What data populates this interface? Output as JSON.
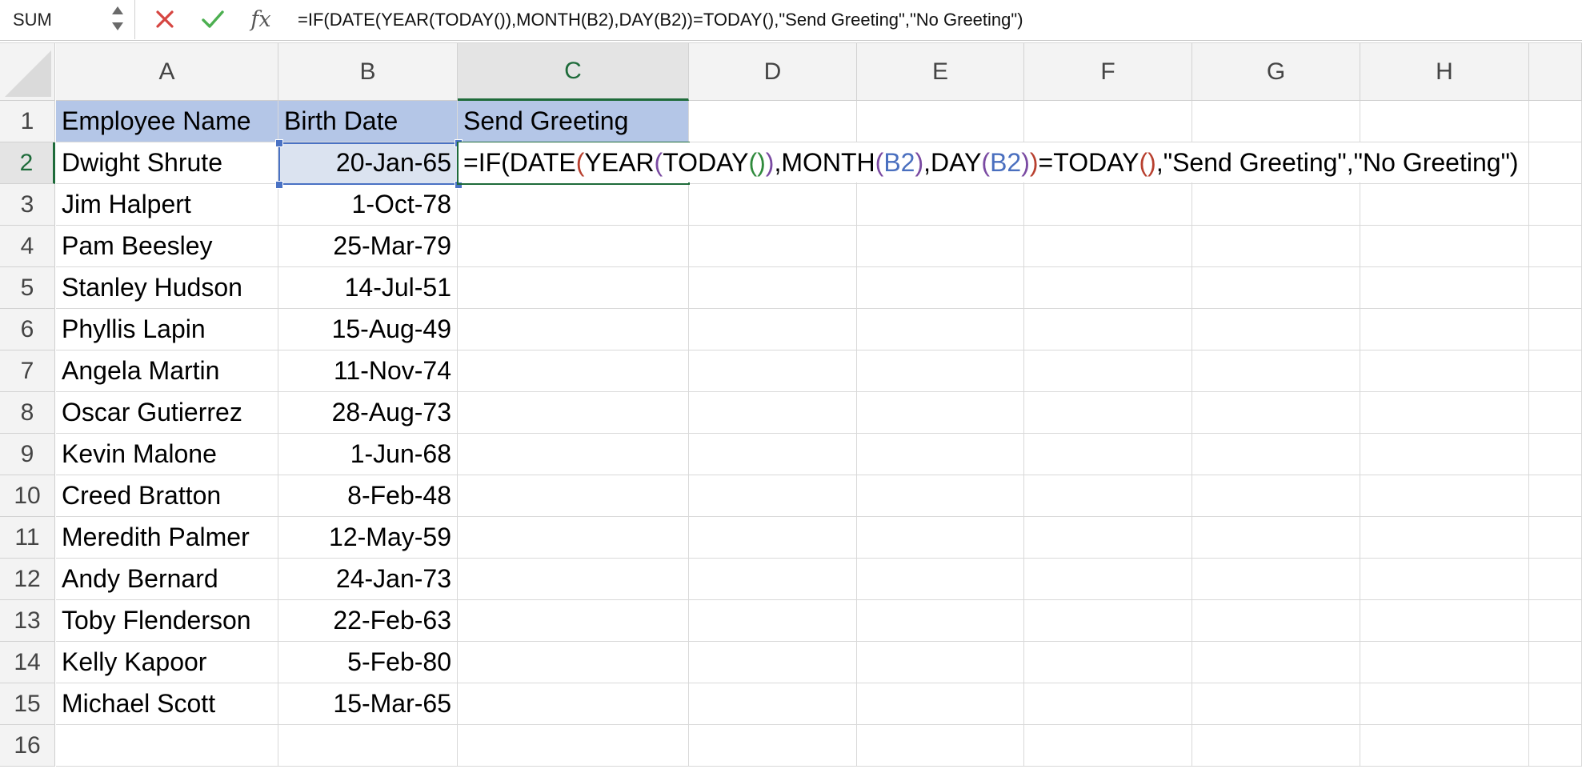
{
  "formula_bar": {
    "name_box": "SUM",
    "fx_label": "fx",
    "formula": "=IF(DATE(YEAR(TODAY()),MONTH(B2),DAY(B2))=TODAY(),\"Send Greeting\",\"No Greeting\")"
  },
  "columns": [
    "A",
    "B",
    "C",
    "D",
    "E",
    "F",
    "G",
    "H"
  ],
  "active_column": "C",
  "active_row": "2",
  "rows": [
    "1",
    "2",
    "3",
    "4",
    "5",
    "6",
    "7",
    "8",
    "9",
    "10",
    "11",
    "12",
    "13",
    "14",
    "15",
    "16"
  ],
  "headers": {
    "a": "Employee Name",
    "b": "Birth Date",
    "c": "Send Greeting"
  },
  "employees": [
    {
      "name": "Dwight Shrute",
      "birth": "20-Jan-65"
    },
    {
      "name": "Jim Halpert",
      "birth": "1-Oct-78"
    },
    {
      "name": "Pam Beesley",
      "birth": "25-Mar-79"
    },
    {
      "name": "Stanley Hudson",
      "birth": "14-Jul-51"
    },
    {
      "name": "Phyllis Lapin",
      "birth": "15-Aug-49"
    },
    {
      "name": "Angela Martin",
      "birth": "11-Nov-74"
    },
    {
      "name": "Oscar Gutierrez",
      "birth": "28-Aug-73"
    },
    {
      "name": "Kevin Malone",
      "birth": "1-Jun-68"
    },
    {
      "name": "Creed Bratton",
      "birth": "8-Feb-48"
    },
    {
      "name": "Meredith Palmer",
      "birth": "12-May-59"
    },
    {
      "name": "Andy Bernard",
      "birth": "24-Jan-73"
    },
    {
      "name": "Toby Flenderson",
      "birth": "22-Feb-63"
    },
    {
      "name": "Kelly Kapoor",
      "birth": "5-Feb-80"
    },
    {
      "name": "Michael Scott",
      "birth": "15-Mar-65"
    }
  ],
  "cell_formula": {
    "tokens": [
      {
        "text": "=IF(DATE",
        "color": ""
      },
      {
        "text": "(",
        "color": "red"
      },
      {
        "text": "YEAR",
        "color": ""
      },
      {
        "text": "(",
        "color": "purple"
      },
      {
        "text": "TODAY",
        "color": ""
      },
      {
        "text": "()",
        "color": "green"
      },
      {
        "text": ")",
        "color": "purple"
      },
      {
        "text": ",MONTH",
        "color": ""
      },
      {
        "text": "(",
        "color": "purple"
      },
      {
        "text": "B2",
        "color": "blue"
      },
      {
        "text": ")",
        "color": "purple"
      },
      {
        "text": ",DAY",
        "color": ""
      },
      {
        "text": "(",
        "color": "purple"
      },
      {
        "text": "B2",
        "color": "blue"
      },
      {
        "text": ")",
        "color": "purple"
      },
      {
        "text": ")",
        "color": "red"
      },
      {
        "text": "=TODAY",
        "color": ""
      },
      {
        "text": "()",
        "color": "red"
      },
      {
        "text": ",\"Send Greeting\",\"No Greeting\")",
        "color": ""
      }
    ]
  },
  "colors": {
    "header_fill": "#b4c6e7",
    "selection_blue": "#4a72c4",
    "active_green": "#1e6b3a",
    "cancel_red": "#d64541",
    "enter_green": "#4caf50"
  }
}
